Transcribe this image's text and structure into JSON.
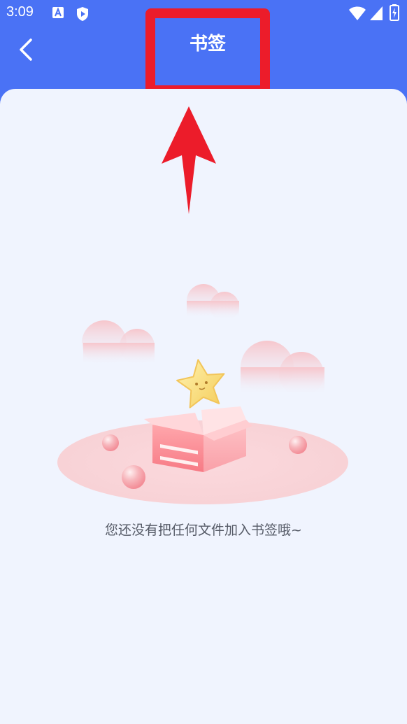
{
  "status_bar": {
    "time": "3:09",
    "icons": [
      "accessibility-icon",
      "shield-play-icon",
      "wifi-icon",
      "signal-icon",
      "battery-icon"
    ]
  },
  "app_bar": {
    "title": "书签",
    "back_icon": "chevron-left-icon"
  },
  "annotation": {
    "highlight_color": "#ec1c2a",
    "arrow_color": "#ec1c2a"
  },
  "empty_state": {
    "message": "您还没有把任何文件加入书签哦~"
  },
  "colors": {
    "primary": "#4a72f5",
    "background": "#f0f4fe",
    "text_secondary": "#555a66"
  }
}
